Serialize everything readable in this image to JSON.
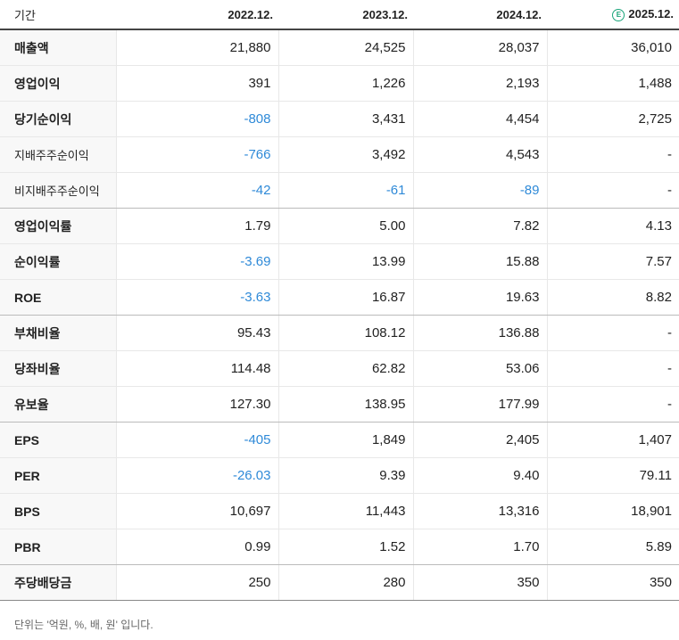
{
  "header": {
    "period_label": "기간",
    "columns": [
      {
        "label": "2022.12.",
        "estimate": false
      },
      {
        "label": "2023.12.",
        "estimate": false
      },
      {
        "label": "2024.12.",
        "estimate": false
      },
      {
        "label": "2025.12.",
        "estimate": true
      }
    ],
    "estimate_icon": "E"
  },
  "rows": [
    {
      "label": "매출액",
      "values": [
        "21,880",
        "24,525",
        "28,037",
        "36,010"
      ]
    },
    {
      "label": "영업이익",
      "values": [
        "391",
        "1,226",
        "2,193",
        "1,488"
      ]
    },
    {
      "label": "당기순이익",
      "values": [
        "-808",
        "3,431",
        "4,454",
        "2,725"
      ]
    },
    {
      "label": "지배주주순이익",
      "values": [
        "-766",
        "3,492",
        "4,543",
        "-"
      ]
    },
    {
      "label": "비지배주주순이익",
      "values": [
        "-42",
        "-61",
        "-89",
        "-"
      ]
    },
    {
      "label": "영업이익률",
      "values": [
        "1.79",
        "5.00",
        "7.82",
        "4.13"
      ]
    },
    {
      "label": "순이익률",
      "values": [
        "-3.69",
        "13.99",
        "15.88",
        "7.57"
      ]
    },
    {
      "label": "ROE",
      "values": [
        "-3.63",
        "16.87",
        "19.63",
        "8.82"
      ]
    },
    {
      "label": "부채비율",
      "values": [
        "95.43",
        "108.12",
        "136.88",
        "-"
      ]
    },
    {
      "label": "당좌비율",
      "values": [
        "114.48",
        "62.82",
        "53.06",
        "-"
      ]
    },
    {
      "label": "유보율",
      "values": [
        "127.30",
        "138.95",
        "177.99",
        "-"
      ]
    },
    {
      "label": "EPS",
      "values": [
        "-405",
        "1,849",
        "2,405",
        "1,407"
      ]
    },
    {
      "label": "PER",
      "values": [
        "-26.03",
        "9.39",
        "9.40",
        "79.11"
      ]
    },
    {
      "label": "BPS",
      "values": [
        "10,697",
        "11,443",
        "13,316",
        "18,901"
      ]
    },
    {
      "label": "PBR",
      "values": [
        "0.99",
        "1.52",
        "1.70",
        "5.89"
      ]
    },
    {
      "label": "주당배당금",
      "values": [
        "250",
        "280",
        "350",
        "350"
      ]
    }
  ],
  "footnote": "단위는 '억원, %, 배, 원' 입니다.",
  "colors": {
    "negative": "#2f8ad8",
    "estimate": "#1aa57a"
  }
}
